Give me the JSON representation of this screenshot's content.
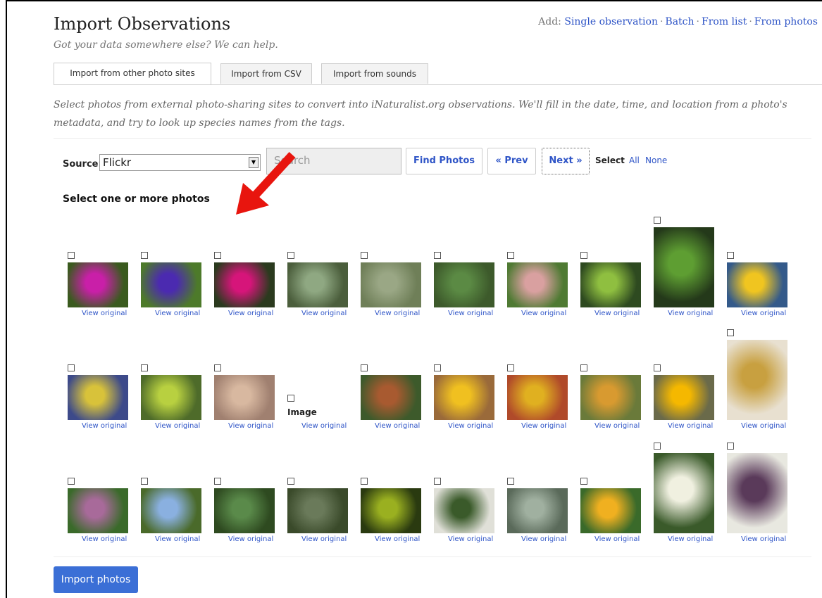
{
  "header": {
    "title": "Import Observations",
    "subtitle": "Got your data somewhere else? We can help.",
    "add_prefix": "Add:",
    "add_links": [
      "Single observation",
      "Batch",
      "From list",
      "From photos"
    ]
  },
  "tabs": [
    {
      "label": "Import from other photo sites",
      "active": true
    },
    {
      "label": "Import from CSV",
      "active": false
    },
    {
      "label": "Import from sounds",
      "active": false
    }
  ],
  "description": "Select photos from external photo-sharing sites to convert into iNaturalist.org observations. We'll fill in the date, time, and location from a photo's metadata, and try to look up species names from the tags.",
  "toolbar": {
    "source_label": "Source:",
    "source_value": "Flickr",
    "search_placeholder": "Search",
    "find_label": "Find Photos",
    "prev_label": "« Prev",
    "next_label": "Next »",
    "select_label": "Select",
    "all_label": "All",
    "none_label": "None"
  },
  "grid": {
    "heading": "Select one or more photos",
    "view_original": "View original",
    "image_placeholder": "Image",
    "rows": [
      [
        {
          "colors": [
            "#c91fa8",
            "#3a5a1e"
          ]
        },
        {
          "colors": [
            "#4b2ab0",
            "#4d7a2a"
          ]
        },
        {
          "colors": [
            "#d6157a",
            "#2b3a1e"
          ]
        },
        {
          "colors": [
            "#8fa882",
            "#4b5e3c"
          ]
        },
        {
          "colors": [
            "#9aa785",
            "#6f7f58"
          ]
        },
        {
          "colors": [
            "#5b8a44",
            "#3d5a2b"
          ]
        },
        {
          "colors": [
            "#d9a0a0",
            "#4f7a33"
          ]
        },
        {
          "colors": [
            "#8fbf40",
            "#2e4a20"
          ]
        },
        {
          "colors": [
            "#5e9e32",
            "#24391a"
          ],
          "tall": true
        },
        {
          "colors": [
            "#f0c520",
            "#345a8a"
          ]
        }
      ],
      [
        {
          "colors": [
            "#d8c23a",
            "#3d4a8a"
          ]
        },
        {
          "colors": [
            "#b8d040",
            "#4e6b2a"
          ]
        },
        {
          "colors": [
            "#d8b8a0",
            "#a08070"
          ]
        },
        {
          "placeholder": true
        },
        {
          "colors": [
            "#a85a30",
            "#3d5a2b"
          ]
        },
        {
          "colors": [
            "#f0c020",
            "#9a6a3a"
          ]
        },
        {
          "colors": [
            "#e0b020",
            "#b04a2a"
          ]
        },
        {
          "colors": [
            "#d89a30",
            "#6a7a3a"
          ]
        },
        {
          "colors": [
            "#f5b800",
            "#6a6a4a"
          ]
        },
        {
          "colors": [
            "#c8a040",
            "#e8e0d0"
          ],
          "tall": true
        }
      ],
      [
        {
          "colors": [
            "#a86a9a",
            "#3a6a2a"
          ]
        },
        {
          "colors": [
            "#8ab0e0",
            "#4a6a2a"
          ]
        },
        {
          "colors": [
            "#5a8a4a",
            "#2e4a20"
          ]
        },
        {
          "colors": [
            "#6a7a5a",
            "#3a4a2a"
          ]
        },
        {
          "colors": [
            "#9ab020",
            "#2a3a10"
          ]
        },
        {
          "colors": [
            "#3a5a2a",
            "#e0e0d8"
          ]
        },
        {
          "colors": [
            "#a0b0a0",
            "#5a6a5a"
          ]
        },
        {
          "colors": [
            "#f0b020",
            "#3a6a2a"
          ]
        },
        {
          "colors": [
            "#f0f0e0",
            "#3a5a2a"
          ],
          "tall": true
        },
        {
          "colors": [
            "#5a3a5a",
            "#e8e8e0"
          ],
          "tall": true
        }
      ]
    ]
  },
  "footer": {
    "import_label": "Import photos"
  },
  "colors": {
    "link": "#2f55c7",
    "primary_button": "#3b6fd6",
    "annotation_arrow": "#e8150e"
  }
}
